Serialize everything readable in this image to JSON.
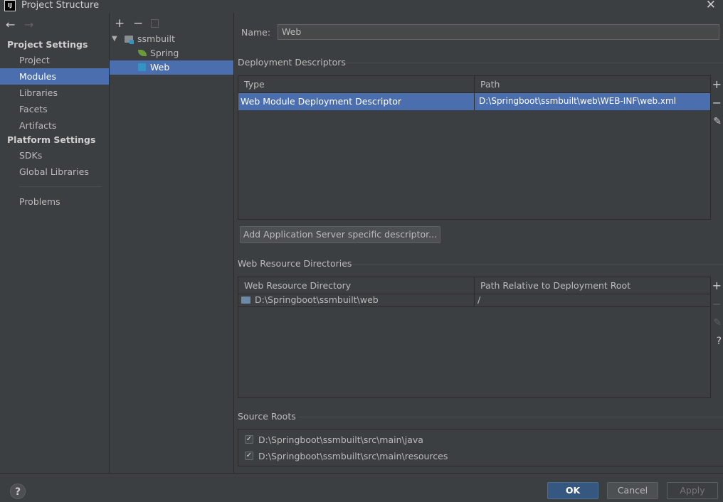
{
  "window": {
    "title": "Project Structure",
    "icon_text": "IJ"
  },
  "nav": {
    "project_settings_heading": "Project Settings",
    "platform_settings_heading": "Platform Settings",
    "items_project": [
      "Project",
      "Modules",
      "Libraries",
      "Facets",
      "Artifacts"
    ],
    "items_platform": [
      "SDKs",
      "Global Libraries"
    ],
    "problems": "Problems",
    "selected": "Modules"
  },
  "tree": {
    "root": "ssmbuilt",
    "children": [
      "Spring",
      "Web"
    ],
    "selected": "Web"
  },
  "name_label": "Name:",
  "name_value": "Web",
  "deployment": {
    "title": "Deployment Descriptors",
    "columns": [
      "Type",
      "Path"
    ],
    "rows": [
      {
        "type": "Web Module Deployment Descriptor",
        "path": "D:\\Springboot\\ssmbuilt\\web\\WEB-INF\\web.xml"
      }
    ],
    "add_button": "Add Application Server specific descriptor..."
  },
  "web_resources": {
    "title": "Web Resource Directories",
    "columns": [
      "Web Resource Directory",
      "Path Relative to Deployment Root"
    ],
    "rows": [
      {
        "dir": "D:\\Springboot\\ssmbuilt\\web",
        "relative": "/"
      }
    ]
  },
  "source_roots": {
    "title": "Source Roots",
    "items": [
      {
        "path": "D:\\Springboot\\ssmbuilt\\src\\main\\java",
        "checked": true
      },
      {
        "path": "D:\\Springboot\\ssmbuilt\\src\\main\\resources",
        "checked": true
      }
    ]
  },
  "buttons": {
    "ok": "OK",
    "cancel": "Cancel",
    "apply": "Apply",
    "help": "?"
  },
  "colors": {
    "background": "#3c3f41",
    "selection": "#4b6eaf",
    "primary_button": "#365880"
  },
  "icons": {
    "back": "arrow-left-icon",
    "forward": "arrow-right-icon",
    "add": "plus-icon",
    "remove": "minus-icon",
    "copy": "copy-icon",
    "edit": "pencil-icon",
    "help": "question-icon",
    "close": "close-icon",
    "module": "module-folder-icon",
    "spring": "spring-leaf-icon",
    "web": "web-facet-icon",
    "folder": "folder-icon",
    "expand": "triangle-down-icon"
  }
}
